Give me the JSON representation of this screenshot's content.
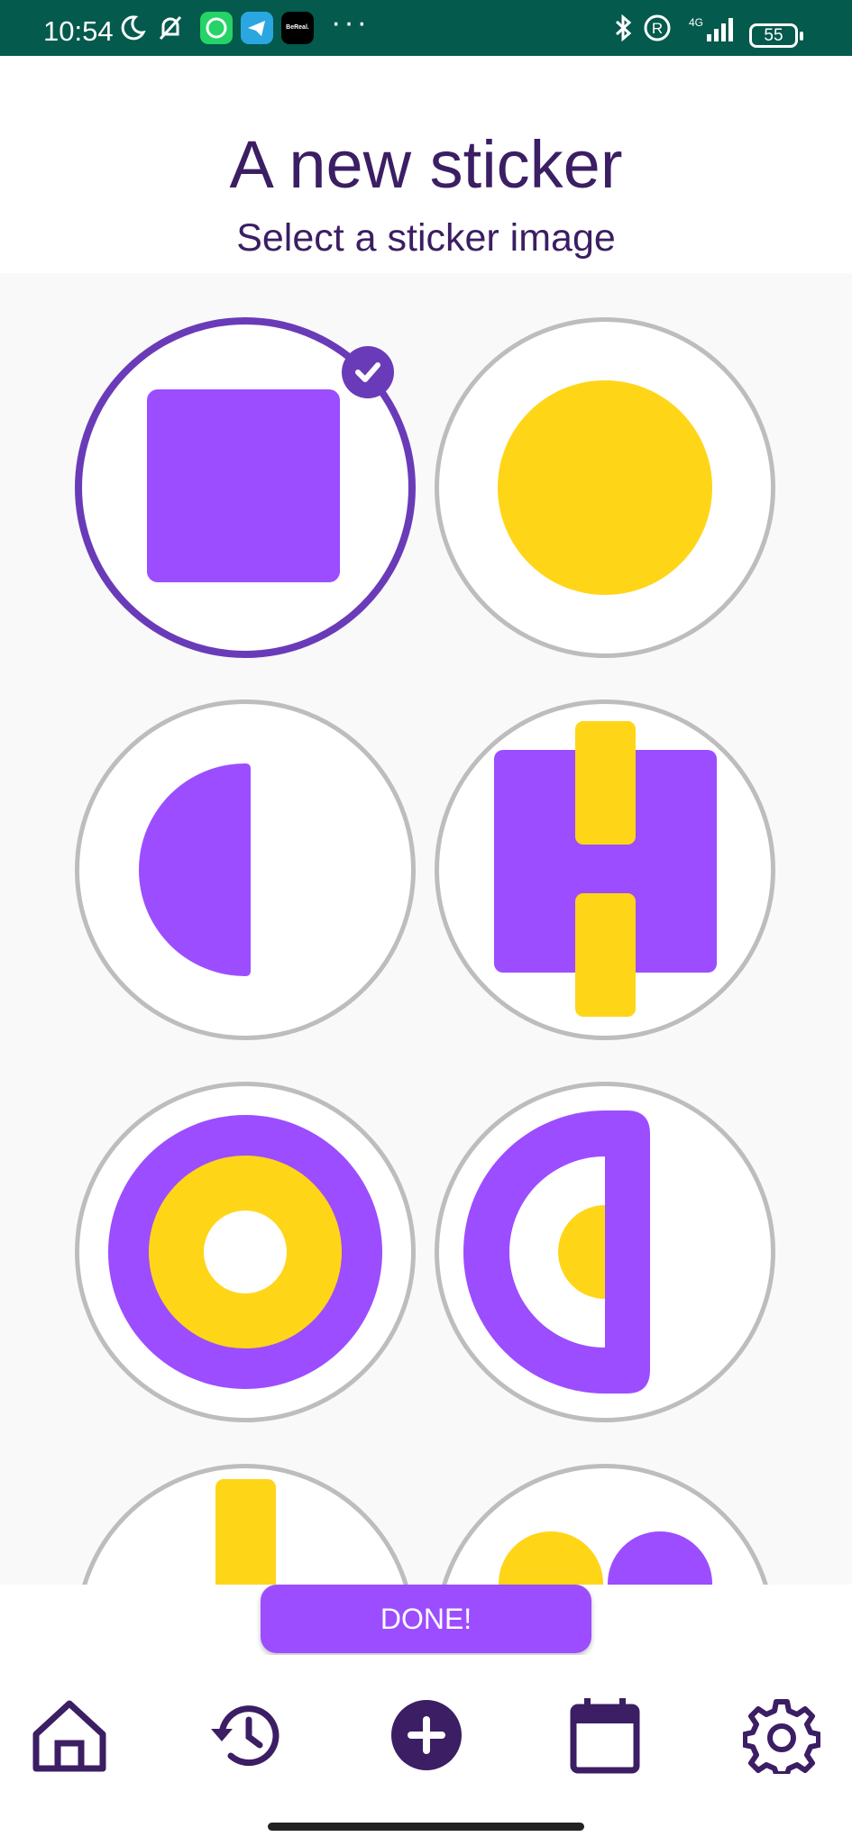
{
  "status_bar": {
    "time": "10:54",
    "app_icons": [
      "moon-icon",
      "notification-muted-icon",
      "whatsapp-icon",
      "telegram-icon",
      "bereal-icon"
    ],
    "bereal_label": "BeReal.",
    "more": "···",
    "network": "4G",
    "battery": "55",
    "right_icons": [
      "bluetooth-icon",
      "registered-icon",
      "signal-icon",
      "battery-icon"
    ]
  },
  "header": {
    "title": "A new sticker",
    "subtitle": "Select a sticker image"
  },
  "stickers": [
    {
      "id": "purple-square",
      "selected": true
    },
    {
      "id": "yellow-circle",
      "selected": false
    },
    {
      "id": "purple-half-circle",
      "selected": false
    },
    {
      "id": "purple-square-yellow-bars",
      "selected": false
    },
    {
      "id": "purple-yellow-rings",
      "selected": false
    },
    {
      "id": "purple-d-yellow-half",
      "selected": false
    },
    {
      "id": "yellow-bar",
      "selected": false
    },
    {
      "id": "yellow-purple-dots",
      "selected": false
    }
  ],
  "done_button": {
    "label": "DONE!"
  },
  "bottom_nav": {
    "items": [
      "home-icon",
      "history-icon",
      "add-icon",
      "calendar-icon",
      "settings-icon"
    ]
  },
  "colors": {
    "status_bar": "#045a4c",
    "text_primary": "#3b1e63",
    "accent_purple": "#9c4dff",
    "selected_border": "#6a3bb8",
    "sticker_yellow": "#ffd518",
    "unselected_border": "#bdbdbd"
  }
}
